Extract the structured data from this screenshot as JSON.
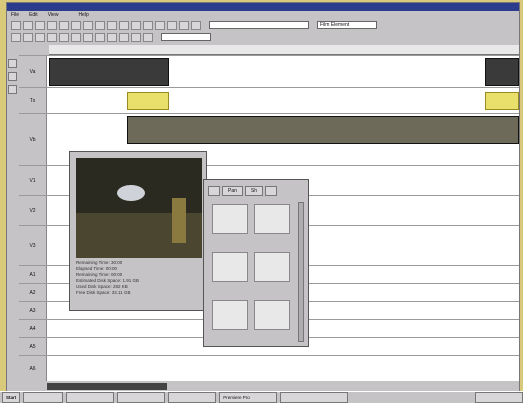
{
  "app": {
    "menu": [
      "File",
      "Edit",
      "View",
      "",
      "Help"
    ],
    "combo_left": "",
    "combo_right_label": "Film Element",
    "ruler_ticks": [
      "",
      "",
      "",
      "",
      "",
      "",
      "",
      "",
      ""
    ]
  },
  "tracks": [
    {
      "label": "Va"
    },
    {
      "label": "Tx"
    },
    {
      "label": "Vb"
    },
    {
      "label": "V1"
    },
    {
      "label": "V2"
    },
    {
      "label": "V3"
    },
    {
      "label": "A1"
    },
    {
      "label": "A2"
    },
    {
      "label": "A3"
    },
    {
      "label": "A4"
    },
    {
      "label": "A5"
    },
    {
      "label": "A6"
    }
  ],
  "monitor": {
    "info_lines": [
      "Remaining Time: 30:00",
      "Elapsed Time: 00:00",
      "Remaining Time: 00:00",
      "Estimated Disk Space: 1.91 GB",
      "Used Disk Space: 282 KB",
      "Free Disk Space: 33.11 GB"
    ]
  },
  "bin": {
    "tabs": [
      "",
      "Pan",
      "Sh",
      ""
    ],
    "items": [
      {
        "num": "1",
        "label": ""
      },
      {
        "num": "2",
        "label": ""
      },
      {
        "num": "3",
        "label": ""
      },
      {
        "num": "4",
        "label": ""
      },
      {
        "num": "5",
        "label": ""
      },
      {
        "num": "6",
        "label": ""
      }
    ]
  },
  "status": {
    "text": ""
  },
  "taskbar": {
    "start": "Start",
    "items": [
      "",
      "",
      "",
      "",
      "Premiere Pro",
      "",
      ""
    ]
  },
  "colors": {
    "desktop": "#d9c97a",
    "window": "#c6c3c6",
    "title": "#2c3c8c",
    "transition": "#e8e06a"
  }
}
